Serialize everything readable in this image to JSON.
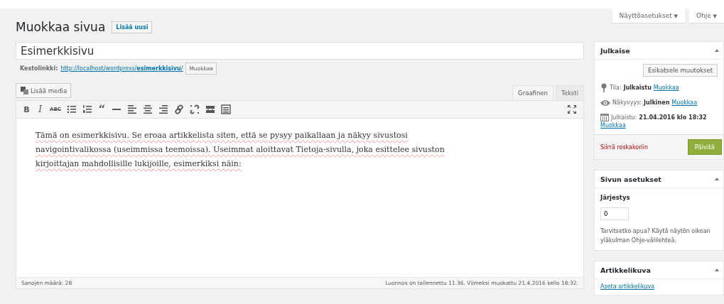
{
  "screen_options": {
    "label": "Näyttöasetukset",
    "caret": "▼"
  },
  "help": {
    "label": "Ohje",
    "caret": "▼"
  },
  "heading": "Muokkaa sivua",
  "add_new": "Lisää uusi",
  "title_field": {
    "value": "Esimerkkisivu"
  },
  "permalink": {
    "label": "Kestolinkki:",
    "url_base": "http://localhost/wordpress/",
    "url_slug": "esimerkkisivu",
    "url_tail": "/",
    "edit": "Muokkaa"
  },
  "add_media": "Lisää media",
  "editor_tabs": [
    {
      "label": "Graafinen",
      "selected": true
    },
    {
      "label": "Teksti",
      "selected": false
    }
  ],
  "toolbar": [
    {
      "kind": "bold",
      "label": "B"
    },
    {
      "kind": "italic",
      "label": "I"
    },
    {
      "kind": "strike",
      "label": "ABC"
    },
    {
      "kind": "bullets"
    },
    {
      "kind": "numbers"
    },
    {
      "kind": "quote",
      "label": "“"
    },
    {
      "kind": "hr"
    },
    {
      "kind": "align-left"
    },
    {
      "kind": "align-center"
    },
    {
      "kind": "align-right"
    },
    {
      "kind": "link"
    },
    {
      "kind": "unlink"
    },
    {
      "kind": "more"
    },
    {
      "kind": "kitchen"
    }
  ],
  "content": "Tämä on esimerkkisivu. Se eroaa artikkelista siten, että se pysyy paikallaan ja näkyy sivustosi navigointivalikossa (useimmissa teemoissa). Useimmat aloittavat Tietoja-sivulla, joka esittelee sivuston kirjoittajan mahdollisille lukijoille, esimerkiksi näin:",
  "word_count": "Sanojen määrä: 28",
  "save_status": "Luonnos on tallennettu 11.36. Viimeksi muokattu 21.4.2016 kello 18:32.",
  "publish": {
    "title": "Julkaise",
    "expanded": true,
    "preview": "Esikatsele muutokset",
    "status_label": "Tila:",
    "status": "Julkaistu",
    "status_edit": "Muokkaa",
    "visibility_label": "Näkyvyys:",
    "visibility": "Julkinen",
    "visibility_edit": "Muokkaa",
    "published_label": "Julkaistu:",
    "published": "21.04.2016 klo 18:32",
    "published_edit": "Muokkaa",
    "trash": "Siirrä roskakoriin",
    "update": "Päivitä"
  },
  "page_attributes": {
    "title": "Sivun asetukset",
    "expanded": true,
    "order_label": "Järjestys",
    "order": "0",
    "help": "Tarvitsetko apua? Käytä näytön oikean yläkulman Ohje-välilehteä."
  },
  "featured_image": {
    "title": "Artikkelikuva",
    "expanded": true,
    "link": "Aseta artikkelikuva"
  }
}
